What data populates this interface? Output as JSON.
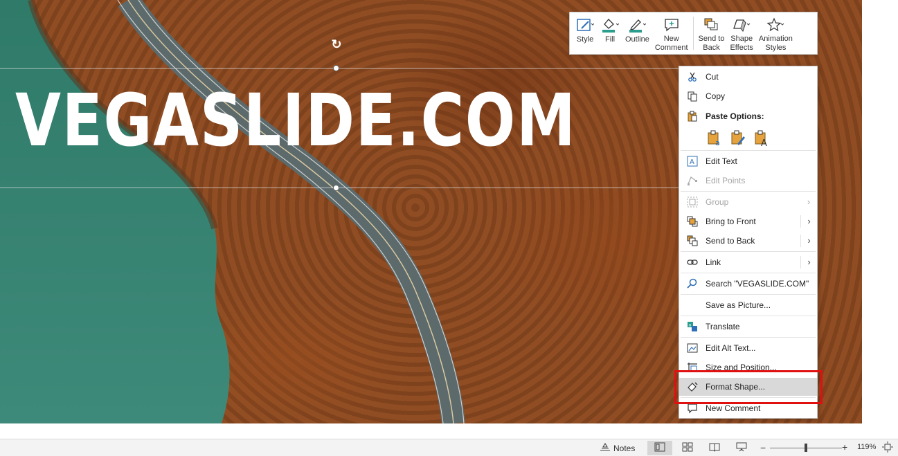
{
  "slide": {
    "title": "VEGASLIDE.COM"
  },
  "mini_toolbar": {
    "buttons": [
      {
        "label": "Style",
        "icon": "style-icon"
      },
      {
        "label": "Fill",
        "icon": "fill-bucket-icon"
      },
      {
        "label": "Outline",
        "icon": "outline-pen-icon"
      },
      {
        "label": "New\nComment",
        "icon": "new-comment-icon"
      },
      {
        "label": "Send to\nBack",
        "icon": "send-to-back-icon"
      },
      {
        "label": "Shape\nEffects",
        "icon": "shape-effects-icon"
      },
      {
        "label": "Animation\nStyles",
        "icon": "animation-star-icon"
      }
    ]
  },
  "context_menu": {
    "cut": "Cut",
    "copy": "Copy",
    "paste_options": "Paste Options:",
    "edit_text": "Edit Text",
    "edit_points": "Edit Points",
    "group": "Group",
    "bring_to_front": "Bring to Front",
    "send_to_back": "Send to Back",
    "link": "Link",
    "search": "Search \"VEGASLIDE.COM\"",
    "save_as_picture": "Save as Picture...",
    "translate": "Translate",
    "edit_alt_text": "Edit Alt Text...",
    "size_and_position": "Size and Position...",
    "format_shape": "Format Shape...",
    "new_comment": "New Comment"
  },
  "status_bar": {
    "notes": "Notes",
    "zoom": "119%"
  },
  "colors": {
    "highlight_box": "#e01010",
    "menu_hover": "#d9d9d9",
    "icon_blue": "#2f6fb7",
    "icon_teal": "#2a9d8f",
    "icon_orange": "#e6a23c"
  }
}
